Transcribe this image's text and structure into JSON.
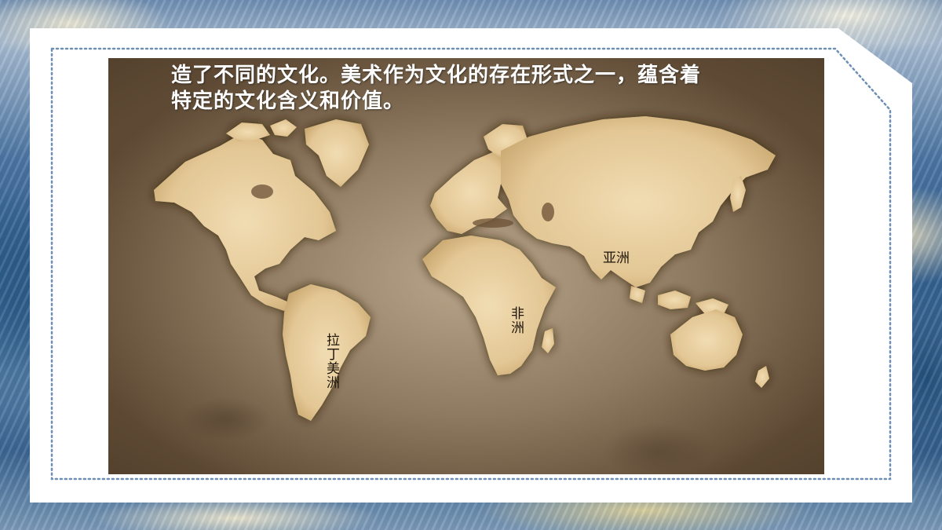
{
  "slide": {
    "text_lines": [
      "造了不同的文化。美术作为文化的存在形式之一，蕴含着",
      "特定的文化含义和价值。"
    ],
    "map_labels": {
      "asia": "亚洲",
      "africa": "非洲",
      "latin_america": "拉丁美洲"
    }
  },
  "colors": {
    "frame_dots": "#6d8fb3",
    "card": "#ffffff",
    "land": "#e8d1a6",
    "label_text": "#1e1408"
  },
  "icons": [
    "world-map-image",
    "oil-painting-background"
  ]
}
